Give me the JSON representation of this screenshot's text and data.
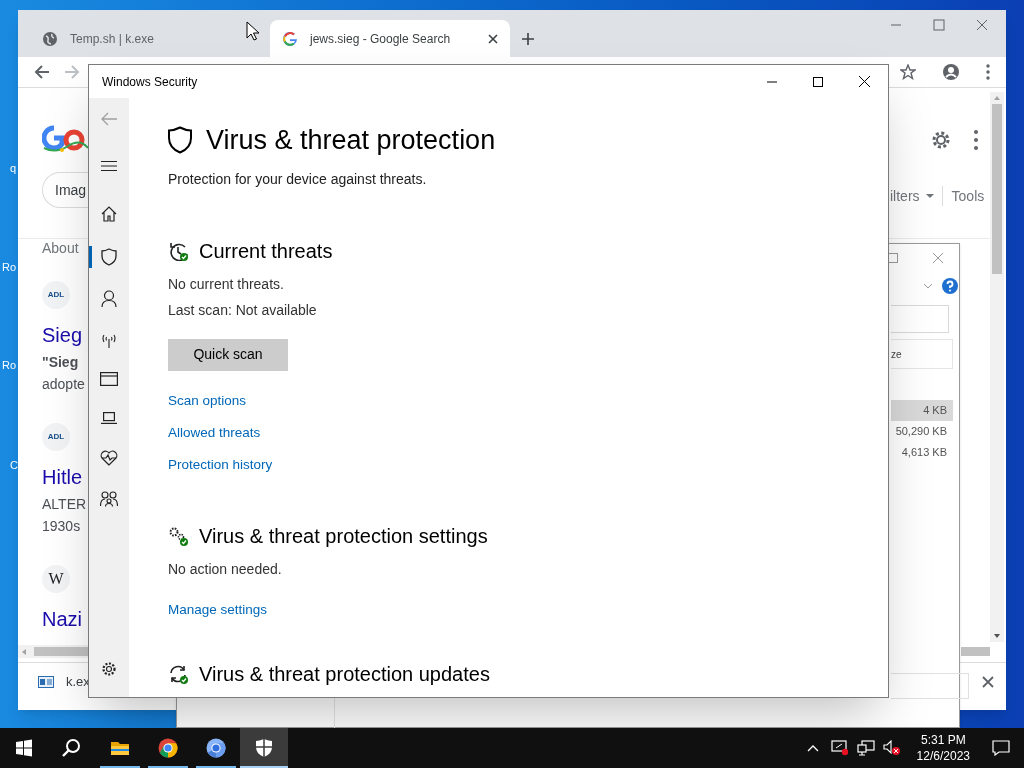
{
  "desktop_icon_labels": [
    "q",
    "Ro",
    "Ro",
    "C"
  ],
  "browser": {
    "tabs": [
      {
        "title": "Temp.sh | k.exe",
        "kind": "globe",
        "selected": false
      },
      {
        "title": "jews.sieg - Google Search",
        "kind": "google",
        "selected": true
      }
    ],
    "page": {
      "chip": "Imag",
      "about": "About",
      "results": [
        {
          "source": "ADL",
          "title": "Sieg",
          "lines": [
            "\"Sieg",
            "adopte"
          ]
        },
        {
          "source": "ADL",
          "title": "Hitle",
          "lines": [
            "ALTER",
            "1930s"
          ]
        },
        {
          "source": "W",
          "title": "Nazi"
        }
      ],
      "filters": "ilters",
      "tools": "Tools"
    },
    "download": {
      "file": "k.ex"
    }
  },
  "explorer": {
    "column": "ze",
    "rows": [
      {
        "size": "4 KB",
        "selected": true
      },
      {
        "size": "50,290 KB",
        "selected": false
      },
      {
        "size": "4,613 KB",
        "selected": false
      }
    ]
  },
  "security": {
    "title": "Windows Security",
    "nav": [
      {
        "kind": "back",
        "disabled": true,
        "selected": false
      },
      {
        "kind": "menu",
        "selected": false
      },
      {
        "kind": "home",
        "selected": false
      },
      {
        "kind": "shield",
        "selected": true
      },
      {
        "kind": "person",
        "selected": false
      },
      {
        "kind": "antenna",
        "selected": false
      },
      {
        "kind": "window",
        "selected": false
      },
      {
        "kind": "laptop",
        "selected": false
      },
      {
        "kind": "heart",
        "selected": false
      },
      {
        "kind": "family",
        "selected": false
      },
      {
        "kind": "settings",
        "selected": false
      }
    ],
    "heading": "Virus & threat protection",
    "subtitle": "Protection for your device against threats.",
    "sections": [
      {
        "kind": "threats",
        "title": "Current threats",
        "lines": [
          "No current threats.",
          "Last scan: Not available"
        ],
        "button": "Quick scan",
        "links": [
          "Scan options",
          "Allowed threats",
          "Protection history"
        ]
      },
      {
        "kind": "settings",
        "title": "Virus & threat protection settings",
        "lines": [
          "No action needed."
        ],
        "links": [
          "Manage settings"
        ]
      },
      {
        "kind": "updates",
        "title": "Virus & threat protection updates"
      }
    ]
  },
  "taskbar": {
    "apps": [
      {
        "kind": "start",
        "running": false,
        "active": false
      },
      {
        "kind": "search",
        "running": false,
        "active": false
      },
      {
        "kind": "folder",
        "running": true,
        "active": false
      },
      {
        "kind": "chrome",
        "running": true,
        "active": false
      },
      {
        "kind": "chromium",
        "running": true,
        "active": false
      },
      {
        "kind": "shield",
        "running": true,
        "active": true
      }
    ],
    "time": "5:31 PM",
    "date": "12/6/2023"
  }
}
